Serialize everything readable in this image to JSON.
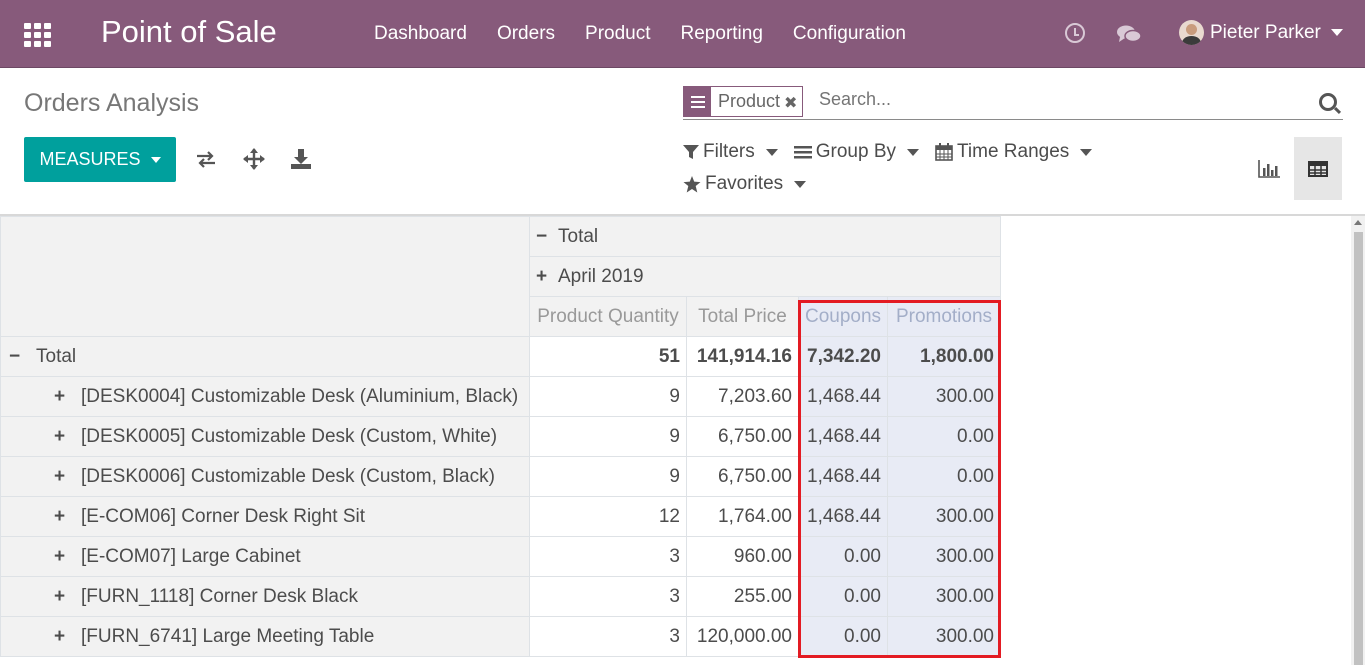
{
  "topbar": {
    "brand": "Point of Sale",
    "menu": [
      "Dashboard",
      "Orders",
      "Product",
      "Reporting",
      "Configuration"
    ],
    "user_name": "Pieter Parker"
  },
  "control": {
    "title": "Orders Analysis",
    "measures_label": "MEASURES",
    "facet_value": "Product",
    "search_placeholder": "Search...",
    "filters_label": "Filters",
    "group_by_label": "Group By",
    "time_ranges_label": "Time Ranges",
    "favorites_label": "Favorites"
  },
  "pivot": {
    "col_total": "Total",
    "col_group": "April 2019",
    "measures": [
      "Product Quantity",
      "Total Price",
      "Coupons",
      "Promotions"
    ],
    "total_row": {
      "label": "Total",
      "values": [
        "51",
        "141,914.16",
        "7,342.20",
        "1,800.00"
      ]
    },
    "rows": [
      {
        "label": "[DESK0004] Customizable Desk (Aluminium, Black)",
        "values": [
          "9",
          "7,203.60",
          "1,468.44",
          "300.00"
        ]
      },
      {
        "label": "[DESK0005] Customizable Desk (Custom, White)",
        "values": [
          "9",
          "6,750.00",
          "1,468.44",
          "0.00"
        ]
      },
      {
        "label": "[DESK0006] Customizable Desk (Custom, Black)",
        "values": [
          "9",
          "6,750.00",
          "1,468.44",
          "0.00"
        ]
      },
      {
        "label": "[E-COM06] Corner Desk Right Sit",
        "values": [
          "12",
          "1,764.00",
          "1,468.44",
          "300.00"
        ]
      },
      {
        "label": "[E-COM07] Large Cabinet",
        "values": [
          "3",
          "960.00",
          "0.00",
          "300.00"
        ]
      },
      {
        "label": "[FURN_1118] Corner Desk Black",
        "values": [
          "3",
          "255.00",
          "0.00",
          "300.00"
        ]
      },
      {
        "label": "[FURN_6741] Large Meeting Table",
        "values": [
          "3",
          "120,000.00",
          "0.00",
          "300.00"
        ]
      }
    ]
  },
  "colors": {
    "topbar": "#875a7b",
    "primary_button": "#00a09d",
    "highlight_box": "#e31b23",
    "highlight_column": "#e8ebf5"
  }
}
